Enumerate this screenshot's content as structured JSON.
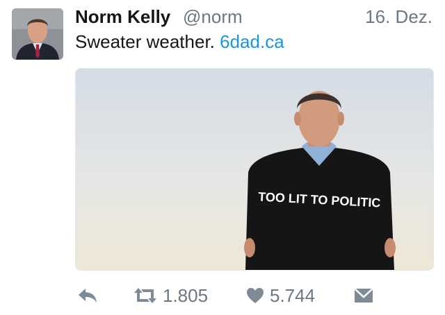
{
  "tweet": {
    "author_name": "Norm Kelly",
    "handle": "@norm",
    "date": "16. Dez.",
    "text": "Sweater weather.",
    "link": "6dad.ca",
    "sweater_text": "TOO LIT TO POLITIC"
  },
  "actions": {
    "reply_icon": "reply-icon",
    "retweet_icon": "retweet-icon",
    "retweet_count": "1.805",
    "like_icon": "heart-icon",
    "like_count": "5.744",
    "message_icon": "envelope-icon"
  },
  "colors": {
    "text": "#14171a",
    "secondary": "#6b7782",
    "link": "#1b95e0",
    "icon": "#7e8b96"
  }
}
